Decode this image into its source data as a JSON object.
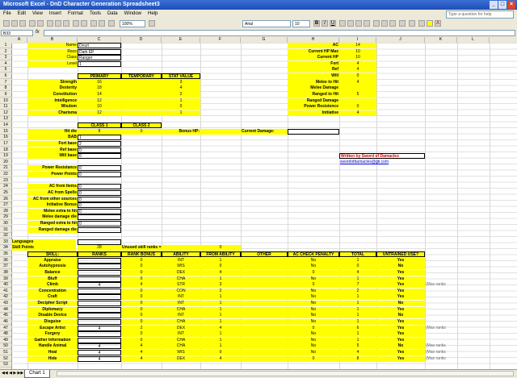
{
  "window": {
    "title": "Microsoft Excel - DnD Character Generation Spreadsheet3"
  },
  "menu": [
    "File",
    "Edit",
    "View",
    "Insert",
    "Format",
    "Tools",
    "Data",
    "Window",
    "Help"
  ],
  "help_placeholder": "Type a question for help",
  "toolbar": {
    "zoom": "100%",
    "font": "Arial",
    "size": "10"
  },
  "formula": {
    "namebox": "B33",
    "fx": "fx"
  },
  "columns": [
    "A",
    "B",
    "C",
    "D",
    "E",
    "F",
    "G",
    "H",
    "I",
    "J",
    "K",
    "L"
  ],
  "rows": [
    "1",
    "2",
    "3",
    "4",
    "5",
    "6",
    "7",
    "8",
    "9",
    "10",
    "11",
    "12",
    "13",
    "14",
    "15",
    "16",
    "17",
    "18",
    "19",
    "20",
    "21",
    "22",
    "23",
    "24",
    "25",
    "26",
    "27",
    "28",
    "29",
    "30",
    "31",
    "32",
    "33",
    "34",
    "35",
    "36",
    "37",
    "38",
    "39",
    "40",
    "41",
    "42",
    "43",
    "44",
    "45",
    "46",
    "47",
    "48",
    "49",
    "50",
    "51",
    "52",
    "53"
  ],
  "char": {
    "name_l": "Name",
    "name": "Drozt",
    "race_l": "Race",
    "race": "Dark Elf",
    "class_l": "Class",
    "class": "Ranger",
    "level_l": "Level",
    "level": "1"
  },
  "stats": {
    "hdr_primary": "PRIMARY",
    "hdr_temp": "TEMPORARY",
    "hdr_val": "STAT VALUE",
    "rows": [
      {
        "l": "Strength",
        "p": "16",
        "v": "3"
      },
      {
        "l": "Dexterity",
        "p": "18",
        "v": "4"
      },
      {
        "l": "Constitution",
        "p": "14",
        "v": "2"
      },
      {
        "l": "Intelligence",
        "p": "12",
        "v": "1"
      },
      {
        "l": "Wisdom",
        "p": "10",
        "v": "0"
      },
      {
        "l": "Charisma",
        "p": "12",
        "v": "1"
      }
    ]
  },
  "right": [
    {
      "l": "AC",
      "v": "14"
    },
    {
      "l": "Current HP Max",
      "v": "10"
    },
    {
      "l": "Current HP",
      "v": "10"
    },
    {
      "l": "Fort",
      "v": "4"
    },
    {
      "l": "Ref",
      "v": "4"
    },
    {
      "l": "Will",
      "v": "0"
    },
    {
      "l": "Melee to Hit",
      "v": "4"
    },
    {
      "l": "Melee Damage",
      "v": ""
    },
    {
      "l": "Ranged to Hit",
      "v": "5"
    },
    {
      "l": "Ranged Damage",
      "v": ""
    },
    {
      "l": "Power Resistence",
      "v": "0"
    },
    {
      "l": "Initiative",
      "v": "4"
    }
  ],
  "classes": {
    "c1": "CLASS 1",
    "c2": "CLASS 2",
    "hitdie_l": "Hit die",
    "hitdie1": "8",
    "hitdie2": "0",
    "bonushp": "Bonus HP:",
    "curdmg": "Current Damage:",
    "bab_l": "BAB",
    "bab": "1",
    "fort_l": "Fort base",
    "fort": "2",
    "ref_l": "Ref base",
    "ref": "0",
    "will_l": "Will base",
    "will": "0"
  },
  "writer": {
    "line1": "Written by Sword of Damacles",
    "line2": "swordofdamacles@gti.com"
  },
  "misc": [
    {
      "l": "Power Resistance",
      "v": "0"
    },
    {
      "l": "Power Points",
      "v": "0"
    }
  ],
  "mods": [
    {
      "l": "AC from Items",
      "v": "0"
    },
    {
      "l": "AC from Spells",
      "v": "0"
    },
    {
      "l": "AC from other sources",
      "v": "0"
    },
    {
      "l": "Initiative Bonus",
      "v": "0"
    },
    {
      "l": "Melee extra to hit",
      "v": "0"
    },
    {
      "l": "Melee damage die",
      "v": ""
    },
    {
      "l": "Ranged extra to hit",
      "v": "0"
    },
    {
      "l": "Ranged damage die",
      "v": ""
    }
  ],
  "languages": "Languages",
  "skillpts": {
    "l": "Skill Points",
    "v": "28",
    "unused_l": "Unused skill ranks =",
    "unused": "0"
  },
  "skillhdr": [
    "SKILL:",
    "RANKS",
    "RANK BONUS",
    "ABILITY",
    "FROM ABILITY",
    "OTHER",
    "AC CHECK PENALTY",
    "TOTAL",
    "UNTRAINED USE?"
  ],
  "skills": [
    {
      "n": "Appraise",
      "r": "",
      "rb": "0",
      "a": "INT",
      "fa": "1",
      "o": "",
      "ac": "No",
      "t": "1",
      "u": "Yes",
      "x": ""
    },
    {
      "n": "Autohypnosis",
      "r": "",
      "rb": "0",
      "a": "WIS",
      "fa": "0",
      "o": "",
      "ac": "No",
      "t": "0",
      "u": "No",
      "x": ""
    },
    {
      "n": "Balance",
      "r": "",
      "rb": "0",
      "a": "DEX",
      "fa": "4",
      "o": "",
      "ac": "0",
      "t": "4",
      "u": "Yes",
      "x": ""
    },
    {
      "n": "Bluff",
      "r": "",
      "rb": "0",
      "a": "CHA",
      "fa": "1",
      "o": "",
      "ac": "No",
      "t": "1",
      "u": "Yes",
      "x": ""
    },
    {
      "n": "Climb",
      "r": "4",
      "rb": "4",
      "a": "STR",
      "fa": "3",
      "o": "",
      "ac": "0",
      "t": "7",
      "u": "Yes",
      "x": "(Max ranks"
    },
    {
      "n": "Concentration",
      "r": "",
      "rb": "0",
      "a": "CON",
      "fa": "2",
      "o": "",
      "ac": "No",
      "t": "2",
      "u": "Yes",
      "x": ""
    },
    {
      "n": "Craft",
      "r": "",
      "rb": "0",
      "a": "INT",
      "fa": "1",
      "o": "",
      "ac": "No",
      "t": "1",
      "u": "Yes",
      "x": ""
    },
    {
      "n": "Decipher Script",
      "r": "",
      "rb": "0",
      "a": "INT",
      "fa": "1",
      "o": "",
      "ac": "No",
      "t": "1",
      "u": "No",
      "x": ""
    },
    {
      "n": "Diplomacy",
      "r": "",
      "rb": "0",
      "a": "CHA",
      "fa": "1",
      "o": "",
      "ac": "No",
      "t": "1",
      "u": "Yes",
      "x": ""
    },
    {
      "n": "Disable Device",
      "r": "",
      "rb": "0",
      "a": "INT",
      "fa": "1",
      "o": "",
      "ac": "No",
      "t": "1",
      "u": "No",
      "x": ""
    },
    {
      "n": "Disguise",
      "r": "",
      "rb": "0",
      "a": "CHA",
      "fa": "1",
      "o": "",
      "ac": "No",
      "t": "1",
      "u": "Yes",
      "x": ""
    },
    {
      "n": "Escape Artist",
      "r": "4",
      "rb": "2",
      "a": "DEX",
      "fa": "4",
      "o": "",
      "ac": "0",
      "t": "6",
      "u": "Yes",
      "x": "(Max ranks"
    },
    {
      "n": "Forgery",
      "r": "",
      "rb": "0",
      "a": "INT",
      "fa": "1",
      "o": "",
      "ac": "No",
      "t": "1",
      "u": "Yes",
      "x": ""
    },
    {
      "n": "Gather Information",
      "r": "",
      "rb": "0",
      "a": "CHA",
      "fa": "1",
      "o": "",
      "ac": "No",
      "t": "1",
      "u": "Yes",
      "x": ""
    },
    {
      "n": "Handle Animal",
      "r": "4",
      "rb": "4",
      "a": "CHA",
      "fa": "1",
      "o": "",
      "ac": "No",
      "t": "5",
      "u": "No",
      "x": "(Max ranks"
    },
    {
      "n": "Heal",
      "r": "4",
      "rb": "4",
      "a": "WIS",
      "fa": "0",
      "o": "",
      "ac": "No",
      "t": "4",
      "u": "Yes",
      "x": "(Max ranks"
    },
    {
      "n": "Hide",
      "r": "4",
      "rb": "4",
      "a": "DEX",
      "fa": "4",
      "o": "",
      "ac": "0",
      "t": "8",
      "u": "Yes",
      "x": "(Max ranks"
    }
  ],
  "sheet_tab": "Chart 1"
}
